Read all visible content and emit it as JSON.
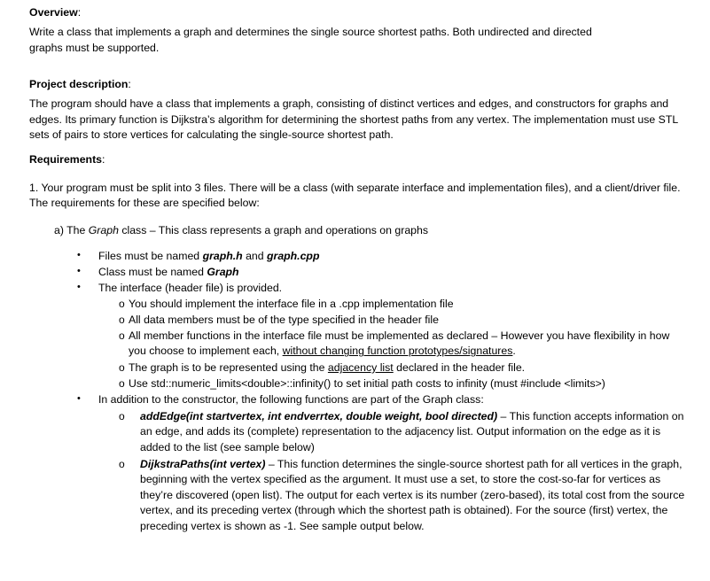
{
  "document": {
    "sections": [
      {
        "id": "overview",
        "heading": "Overview",
        "heading_colon": ":",
        "paragraph": "Write a class that implements a graph and determines the single source shortest paths.  Both undirected and directed graphs must be supported."
      },
      {
        "id": "project-description",
        "heading": "Project description",
        "heading_colon": ":",
        "paragraph": "The program should have a class that implements a graph, consisting of distinct vertices and edges, and constructors for graphs and edges. Its primary function is Dijkstra’s algorithm for determining the shortest paths from any vertex.  The implementation must use STL sets of pairs to store vertices for calculating the single-source shortest path."
      },
      {
        "id": "requirements",
        "heading": "Requirements",
        "heading_colon": ":",
        "item_1": "1.  Your program must be split into 3 files.  There will be a class (with separate interface and implementation files), and a client/driver file.  The requirements for these are specified below:",
        "item_a_prefix": "a) The ",
        "item_a_italic": "Graph",
        "item_a_suffix": " class – This class represents a graph and operations on graphs"
      }
    ],
    "bullets": {
      "marker_filled": "•",
      "marker_hollow": "o",
      "files_must_be_named_prefix": "Files must be named ",
      "files_graph_h": "graph.h",
      "files_and": " and ",
      "files_graph_cpp": "graph.cpp",
      "class_must_be_named_prefix": "Class must be named ",
      "class_graph": "Graph",
      "interface_provided": "The interface (header file) is provided.",
      "sub_implement_cpp": "You should implement the interface file in a .cpp implementation file",
      "sub_data_members": "All data members must be of the type specified in the header file",
      "sub_member_functions_prefix": "All member functions in the interface file must be implemented as declared – However you have flexibility in how you choose to implement each, ",
      "sub_member_functions_underlined": "without changing function prototypes/signatures",
      "sub_member_functions_suffix": ".",
      "sub_graph_repr_prefix": "The graph is to be represented using the ",
      "sub_graph_repr_underlined": "adjacency list",
      "sub_graph_repr_suffix": " declared in the header file.",
      "sub_numeric_limits": "Use std::numeric_limits<double>::infinity() to set initial path costs to infinity (must #include <limits>)",
      "in_addition": "In addition to the constructor, the following functions are part of the Graph class:",
      "add_edge_signature": "addEdge(int startvertex, int endverrtex, double weight, bool directed)",
      "add_edge_desc": " – This function accepts information on an edge, and adds its (complete) representation to the adjacency list.  Output information on the edge as it is added to the list (see sample below)",
      "dijkstra_signature": "DijkstraPaths(int vertex)",
      "dijkstra_desc": " – This function determines the single-source shortest path for all vertices in the graph, beginning with the vertex specified as the argument.  It must use a set, to store the cost-so-far for vertices as they’re discovered (open list).  The output for each vertex is its number (zero-based), its total cost from the source vertex, and its preceding vertex (through which the shortest path is obtained).  For the source (first) vertex, the preceding vertex is shown as -1. See sample output below."
    }
  }
}
